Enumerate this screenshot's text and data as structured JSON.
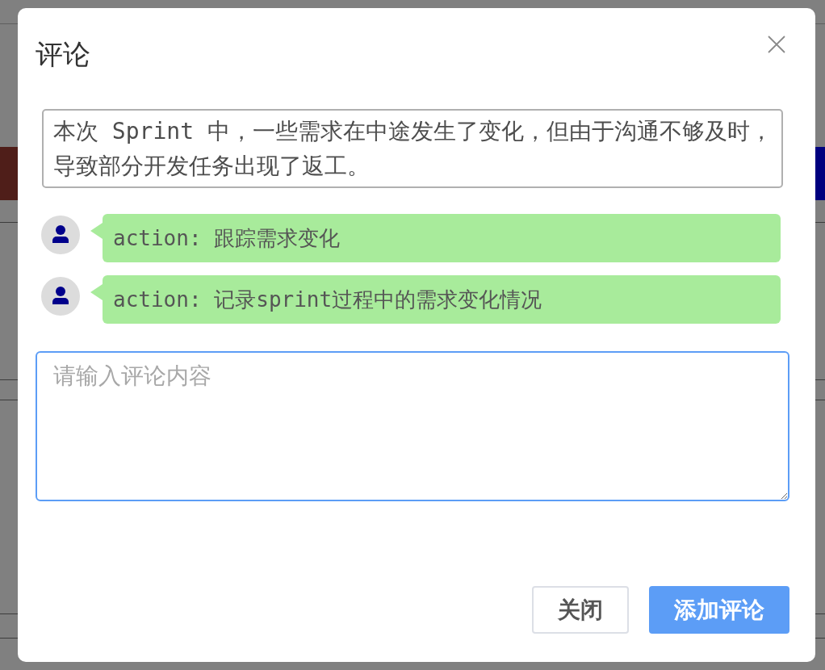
{
  "dialog": {
    "title": "评论",
    "description": "本次 Sprint 中，一些需求在中途发生了变化，但由于沟通不够及时，导致部分开发任务出现了返工。",
    "comments": [
      {
        "text": "action: 跟踪需求变化"
      },
      {
        "text": "action: 记录sprint过程中的需求变化情况"
      }
    ],
    "comment_input": {
      "placeholder": "请输入评论内容"
    },
    "buttons": [
      {
        "label": "关闭",
        "kind": "secondary"
      },
      {
        "label": "添加评论",
        "kind": "primary"
      }
    ]
  }
}
